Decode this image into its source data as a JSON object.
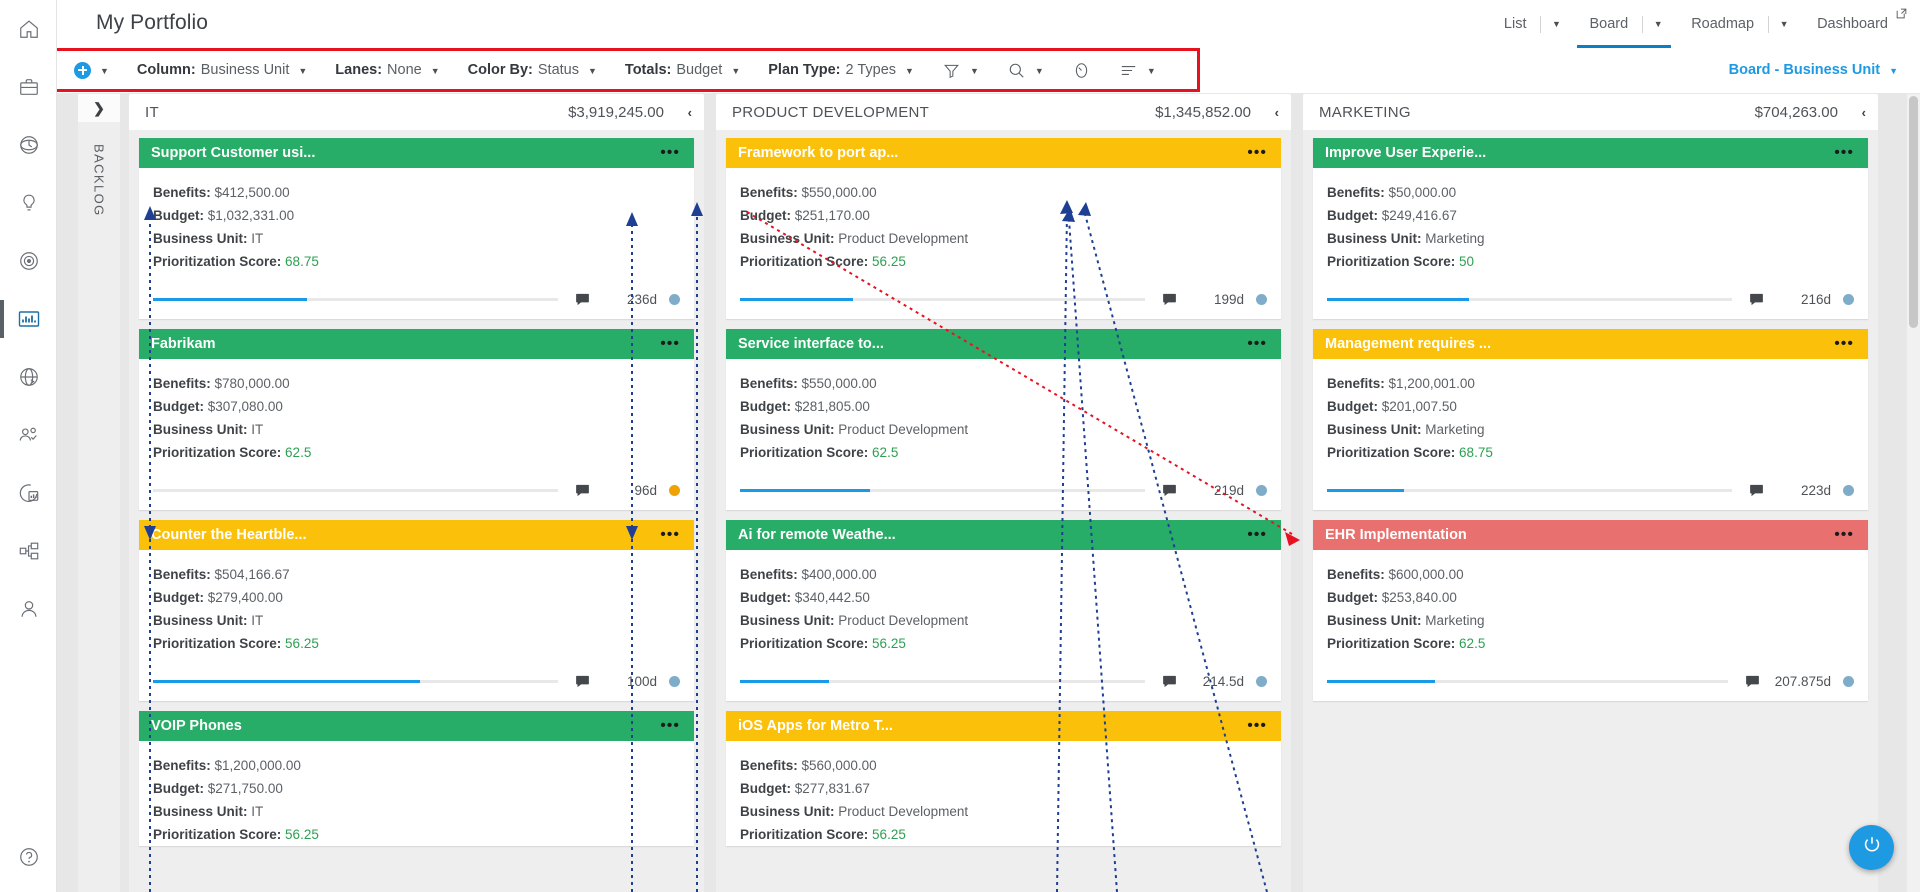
{
  "header": {
    "title": "My Portfolio",
    "nav": [
      {
        "label": "List",
        "icon": "chevron-down-icon",
        "active": false
      },
      {
        "label": "Board",
        "icon": "chevron-down-icon",
        "active": true
      },
      {
        "label": "Roadmap",
        "icon": "chevron-down-icon",
        "active": false
      },
      {
        "label": "Dashboard",
        "icon": "open-external-icon",
        "active": false
      }
    ]
  },
  "rail": {
    "items": [
      {
        "name": "home-icon"
      },
      {
        "name": "briefcase-icon"
      },
      {
        "name": "time-clock-icon"
      },
      {
        "name": "lightbulb-icon"
      },
      {
        "name": "target-icon"
      },
      {
        "name": "portfolio-chart-icon"
      },
      {
        "name": "globe-network-icon"
      },
      {
        "name": "people-check-icon"
      },
      {
        "name": "reports-pie-icon"
      },
      {
        "name": "org-structure-icon"
      },
      {
        "name": "user-icon"
      },
      {
        "name": "help-icon"
      }
    ]
  },
  "toolbar": {
    "add_icon": "add-circle-icon",
    "add_caret": "▼",
    "groups": [
      {
        "key": "Column:",
        "value": "Business Unit",
        "caret": "▼",
        "name": "column-selector"
      },
      {
        "key": "Lanes:",
        "value": "None",
        "caret": "▼",
        "name": "lanes-selector"
      },
      {
        "key": "Color By:",
        "value": "Status",
        "caret": "▼",
        "name": "color-by-selector"
      },
      {
        "key": "Totals:",
        "value": "Budget",
        "caret": "▼",
        "name": "totals-selector"
      },
      {
        "key": "Plan Type:",
        "value": "2 Types",
        "caret": "▼",
        "name": "plan-type-selector"
      }
    ],
    "icons": [
      {
        "name": "filter-icon",
        "caret": "▼"
      },
      {
        "name": "search-icon",
        "caret": "▼"
      },
      {
        "name": "gauge-icon",
        "caret": ""
      },
      {
        "name": "list-settings-icon",
        "caret": "▼"
      }
    ],
    "view_label": "Board - Business Unit",
    "view_caret": "▼",
    "highlight_color": "#e8121f"
  },
  "backlog": {
    "label": "BACKLOG",
    "toggle_icon": "chevron-right-icon"
  },
  "board": {
    "collapse_icon": "‹",
    "menu_icon": "•••",
    "comment_icon": "comment-icon",
    "colors": {
      "green": "#27ad67",
      "yellow": "#fbc10a",
      "red": "#e8706f",
      "progress": "#189ae6",
      "dot_blue": "#7fadc9",
      "dot_orange": "#f0a202",
      "score": "#2e9f52"
    },
    "columns": [
      {
        "name": "IT",
        "total": "$3,919,245.00",
        "cards": [
          {
            "title": "Support Customer usi...",
            "color": "green",
            "benefits_label": "Benefits:",
            "benefits": "$412,500.00",
            "budget_label": "Budget:",
            "budget": "$1,032,331.00",
            "bu_label": "Business Unit:",
            "business_unit": "IT",
            "score_label": "Prioritization Score:",
            "score": "68.75",
            "progress": 38,
            "days": "236d",
            "dot": "blue"
          },
          {
            "title": "Fabrikam",
            "color": "green",
            "benefits_label": "Benefits:",
            "benefits": "$780,000.00",
            "budget_label": "Budget:",
            "budget": "$307,080.00",
            "bu_label": "Business Unit:",
            "business_unit": "IT",
            "score_label": "Prioritization Score:",
            "score": "62.5",
            "progress": 0,
            "days": "96d",
            "dot": "orange"
          },
          {
            "title": "Counter the Heartble...",
            "color": "yellow",
            "benefits_label": "Benefits:",
            "benefits": "$504,166.67",
            "budget_label": "Budget:",
            "budget": "$279,400.00",
            "bu_label": "Business Unit:",
            "business_unit": "IT",
            "score_label": "Prioritization Score:",
            "score": "56.25",
            "progress": 66,
            "days": "100d",
            "dot": "blue"
          },
          {
            "title": "VOIP Phones",
            "color": "green",
            "benefits_label": "Benefits:",
            "benefits": "$1,200,000.00",
            "budget_label": "Budget:",
            "budget": "$271,750.00",
            "bu_label": "Business Unit:",
            "business_unit": "IT",
            "score_label": "Prioritization Score:",
            "score": "56.25",
            "progress": 0,
            "days": "",
            "dot": "blue"
          }
        ]
      },
      {
        "name": "PRODUCT DEVELOPMENT",
        "total": "$1,345,852.00",
        "cards": [
          {
            "title": "Framework to port ap...",
            "color": "yellow",
            "benefits_label": "Benefits:",
            "benefits": "$550,000.00",
            "budget_label": "Budget:",
            "budget": "$251,170.00",
            "bu_label": "Business Unit:",
            "business_unit": "Product Development",
            "score_label": "Prioritization Score:",
            "score": "56.25",
            "progress": 28,
            "days": "199d",
            "dot": "blue"
          },
          {
            "title": "Service interface to...",
            "color": "green",
            "benefits_label": "Benefits:",
            "benefits": "$550,000.00",
            "budget_label": "Budget:",
            "budget": "$281,805.00",
            "bu_label": "Business Unit:",
            "business_unit": "Product Development",
            "score_label": "Prioritization Score:",
            "score": "62.5",
            "progress": 32,
            "days": "219d",
            "dot": "blue"
          },
          {
            "title": "Ai for remote Weathe...",
            "color": "green",
            "benefits_label": "Benefits:",
            "benefits": "$400,000.00",
            "budget_label": "Budget:",
            "budget": "$340,442.50",
            "bu_label": "Business Unit:",
            "business_unit": "Product Development",
            "score_label": "Prioritization Score:",
            "score": "56.25",
            "progress": 22,
            "days": "214.5d",
            "dot": "blue"
          },
          {
            "title": "iOS Apps for Metro T...",
            "color": "yellow",
            "benefits_label": "Benefits:",
            "benefits": "$560,000.00",
            "budget_label": "Budget:",
            "budget": "$277,831.67",
            "bu_label": "Business Unit:",
            "business_unit": "Product Development",
            "score_label": "Prioritization Score:",
            "score": "56.25",
            "progress": 0,
            "days": "",
            "dot": "blue"
          }
        ]
      },
      {
        "name": "MARKETING",
        "total": "$704,263.00",
        "cards": [
          {
            "title": "Improve User Experie...",
            "color": "green",
            "benefits_label": "Benefits:",
            "benefits": "$50,000.00",
            "budget_label": "Budget:",
            "budget": "$249,416.67",
            "bu_label": "Business Unit:",
            "business_unit": "Marketing",
            "score_label": "Prioritization Score:",
            "score": "50",
            "progress": 35,
            "days": "216d",
            "dot": "blue"
          },
          {
            "title": "Management requires ...",
            "color": "yellow",
            "benefits_label": "Benefits:",
            "benefits": "$1,200,001.00",
            "budget_label": "Budget:",
            "budget": "$201,007.50",
            "bu_label": "Business Unit:",
            "business_unit": "Marketing",
            "score_label": "Prioritization Score:",
            "score": "68.75",
            "progress": 19,
            "days": "223d",
            "dot": "blue"
          },
          {
            "title": "EHR Implementation",
            "color": "red",
            "benefits_label": "Benefits:",
            "benefits": "$600,000.00",
            "budget_label": "Budget:",
            "budget": "$253,840.00",
            "bu_label": "Business Unit:",
            "business_unit": "Marketing",
            "score_label": "Prioritization Score:",
            "score": "62.5",
            "progress": 27,
            "days": "207.875d",
            "dot": "blue"
          }
        ]
      }
    ]
  },
  "fab": {
    "icon": "power-feedback-icon"
  }
}
